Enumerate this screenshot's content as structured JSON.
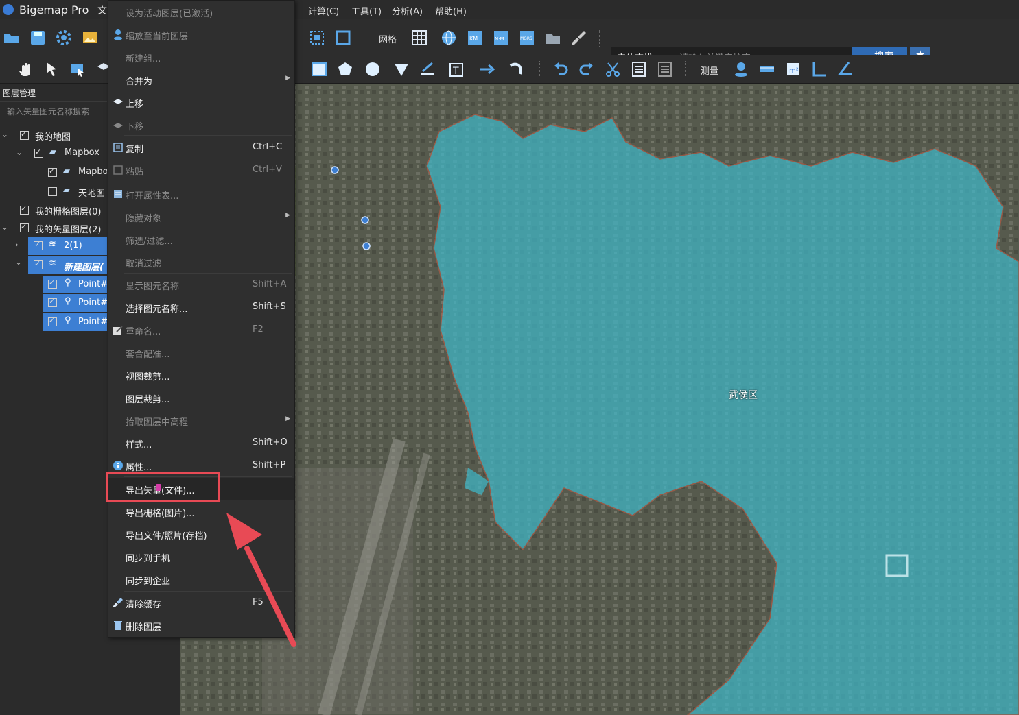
{
  "app": {
    "title": "Bigemap Pro"
  },
  "menubar": {
    "file": "文",
    "items": [
      "计算(C)",
      "工具(T)",
      "分析(A)",
      "帮助(H)"
    ]
  },
  "toolbar1": {
    "grid_label": "网格",
    "search_type": "定位查找",
    "search_placeholder": "请输入关键字检索",
    "search_button": "搜索"
  },
  "toolbar2": {
    "measure_label": "测量"
  },
  "layer_panel": {
    "title": "图层管理",
    "search_placeholder": "输入矢量图元名称搜索",
    "tree": [
      {
        "label": "我的地图",
        "checked": true
      },
      {
        "label": "Mapbox",
        "checked": true
      },
      {
        "label": "Mapbo",
        "checked": true
      },
      {
        "label": "天地图",
        "checked": false
      },
      {
        "label": "我的栅格图层(0)",
        "checked": true
      },
      {
        "label": "我的矢量图层(2)",
        "checked": true
      },
      {
        "label": "2(1)",
        "checked": true
      },
      {
        "label": "新建图层(",
        "checked": true
      },
      {
        "label": "Point#",
        "checked": true
      },
      {
        "label": "Point#",
        "checked": true
      },
      {
        "label": "Point#",
        "checked": true
      }
    ]
  },
  "map": {
    "district_label": "武侯区"
  },
  "context_menu": {
    "items": [
      {
        "label": "设为活动图层(已激活)",
        "shortcut": "",
        "disabled": true
      },
      {
        "label": "缩放至当前图层",
        "shortcut": "",
        "disabled": true
      },
      {
        "label": "新建组...",
        "shortcut": "",
        "disabled": true
      },
      {
        "label": "合并为",
        "shortcut": "",
        "disabled": false
      },
      {
        "label": "上移",
        "shortcut": "",
        "disabled": false
      },
      {
        "label": "下移",
        "shortcut": "",
        "disabled": true
      },
      {
        "label": "复制",
        "shortcut": "Ctrl+C",
        "disabled": false
      },
      {
        "label": "粘贴",
        "shortcut": "Ctrl+V",
        "disabled": true
      },
      {
        "label": "打开属性表...",
        "shortcut": "",
        "disabled": true
      },
      {
        "label": "隐藏对象",
        "shortcut": "",
        "disabled": true
      },
      {
        "label": "筛选/过滤...",
        "shortcut": "",
        "disabled": true
      },
      {
        "label": "取消过滤",
        "shortcut": "",
        "disabled": true
      },
      {
        "label": "显示图元名称",
        "shortcut": "Shift+A",
        "disabled": true
      },
      {
        "label": "选择图元名称...",
        "shortcut": "Shift+S",
        "disabled": false
      },
      {
        "label": "重命名...",
        "shortcut": "F2",
        "disabled": true
      },
      {
        "label": "套合配准...",
        "shortcut": "",
        "disabled": true
      },
      {
        "label": "视图裁剪...",
        "shortcut": "",
        "disabled": false
      },
      {
        "label": "图层裁剪...",
        "shortcut": "",
        "disabled": false
      },
      {
        "label": "拾取图层中高程",
        "shortcut": "",
        "disabled": true
      },
      {
        "label": "样式...",
        "shortcut": "Shift+O",
        "disabled": false
      },
      {
        "label": "属性...",
        "shortcut": "Shift+P",
        "disabled": false
      },
      {
        "label": "导出矢量(文件)...",
        "shortcut": "",
        "disabled": false
      },
      {
        "label": "导出栅格(图片)...",
        "shortcut": "",
        "disabled": false
      },
      {
        "label": "导出文件/照片(存档)",
        "shortcut": "",
        "disabled": false
      },
      {
        "label": "同步到手机",
        "shortcut": "",
        "disabled": false
      },
      {
        "label": "同步到企业",
        "shortcut": "",
        "disabled": false
      },
      {
        "label": "清除缓存",
        "shortcut": "F5",
        "disabled": false
      },
      {
        "label": "删除图层",
        "shortcut": "",
        "disabled": false
      }
    ]
  },
  "colors": {
    "accent": "#3d7fd3",
    "highlight": "#e84a55",
    "overlay": "#3fb7c8"
  }
}
